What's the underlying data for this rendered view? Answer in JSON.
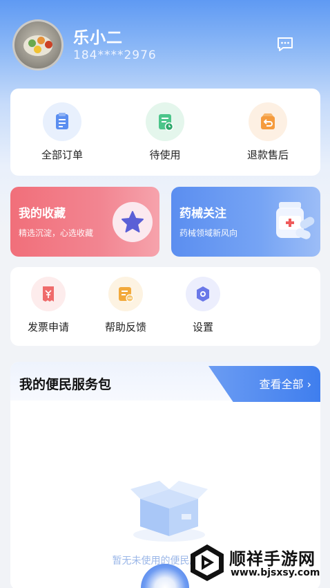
{
  "profile": {
    "name": "乐小二",
    "phone": "184****2976"
  },
  "orders": [
    {
      "label": "全部订单",
      "icon": "order-list-icon",
      "color": "#5b8ef0",
      "bg": "#e8f0fd"
    },
    {
      "label": "待使用",
      "icon": "pending-use-icon",
      "color": "#4cc58a",
      "bg": "#e4f6ec"
    },
    {
      "label": "退款售后",
      "icon": "refund-icon",
      "color": "#f59b3d",
      "bg": "#fdf0e3"
    }
  ],
  "promos": {
    "favorites": {
      "title": "我的收藏",
      "subtitle": "精选沉淀，心选收藏"
    },
    "medical": {
      "title": "药械关注",
      "subtitle": "药械领域新风向"
    }
  },
  "tools": [
    {
      "label": "发票申请",
      "icon": "invoice-icon",
      "color": "#ef6b6b",
      "bg": "#fdecec"
    },
    {
      "label": "帮助反馈",
      "icon": "feedback-icon",
      "color": "#f2a93b",
      "bg": "#fdf3e2"
    },
    {
      "label": "设置",
      "icon": "settings-icon",
      "color": "#6a78e8",
      "bg": "#eceefd"
    }
  ],
  "service_pack": {
    "title": "我的便民服务包",
    "more": "查看全部",
    "empty_text": "暂无未使用的便民服务包"
  },
  "watermark": {
    "name": "顺祥手游网",
    "url": "www.bjsxsy.com"
  },
  "colors": {
    "accent": "#4a86ee",
    "favorites": "#f16f7a",
    "medical": "#5b8ef0"
  }
}
